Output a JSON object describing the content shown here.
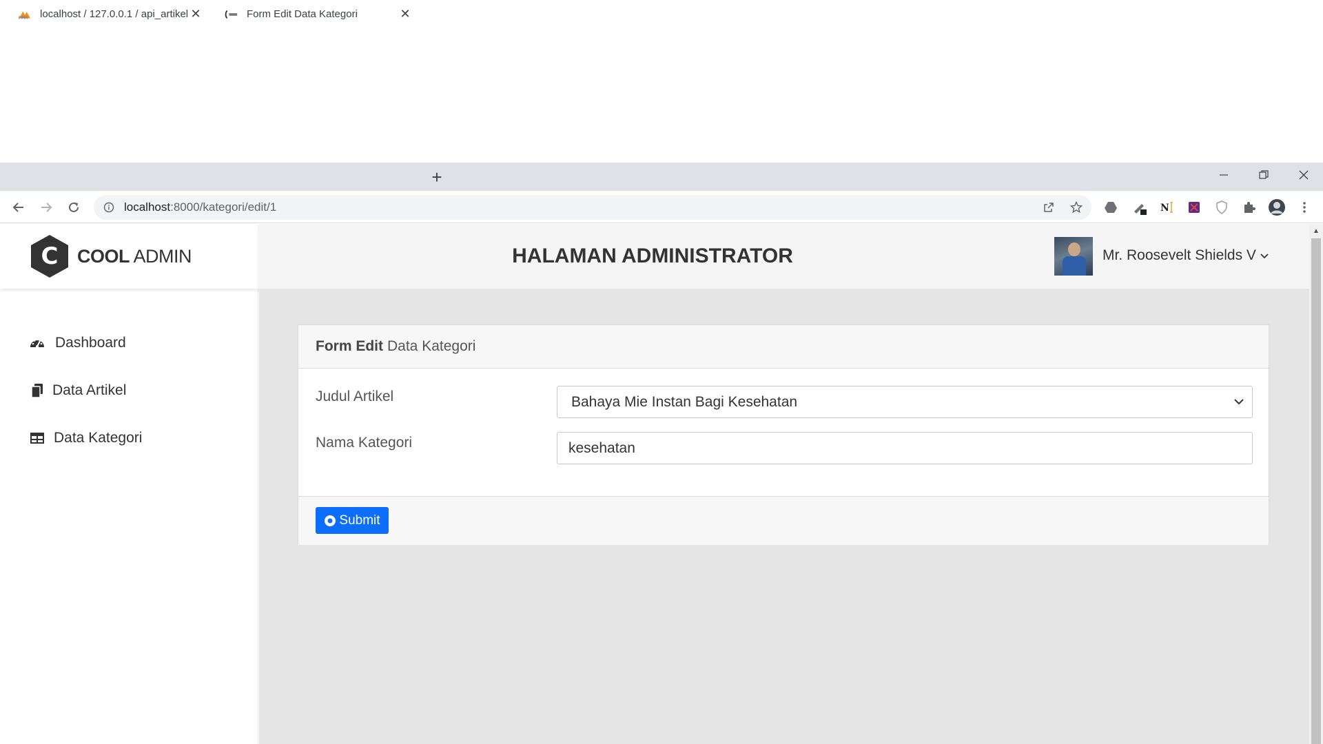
{
  "browser": {
    "tabs": [
      {
        "title": "localhost / 127.0.0.1 / api_artikel",
        "active": false,
        "icon": "phpmyadmin-icon"
      },
      {
        "title": "Form Edit Data Kategori",
        "active": true,
        "icon": "site-favicon"
      }
    ],
    "url_host": "localhost",
    "url_path": ":8000/kategori/edit/1"
  },
  "sidebar": {
    "logo_bold": "COOL",
    "logo_light": "ADMIN",
    "logo_letter": "C",
    "items": [
      {
        "label": "Dashboard",
        "icon": "tachometer-icon"
      },
      {
        "label": "Data Artikel",
        "icon": "copy-icon"
      },
      {
        "label": "Data Kategori",
        "icon": "table-icon"
      }
    ]
  },
  "header": {
    "title": "HALAMAN ADMINISTRATOR",
    "user_name": "Mr. Roosevelt Shields V"
  },
  "form": {
    "title_bold": "Form Edit",
    "title_rest": "Data Kategori",
    "label_artikel": "Judul Artikel",
    "selected_artikel": "Bahaya Mie Instan Bagi Kesehatan",
    "label_kategori": "Nama Kategori",
    "kategori_value": "kesehatan",
    "submit_label": "Submit"
  },
  "colors": {
    "primary": "#0d6efd",
    "header_bg": "#f5f5f5",
    "content_bg": "#e5e5e5"
  }
}
